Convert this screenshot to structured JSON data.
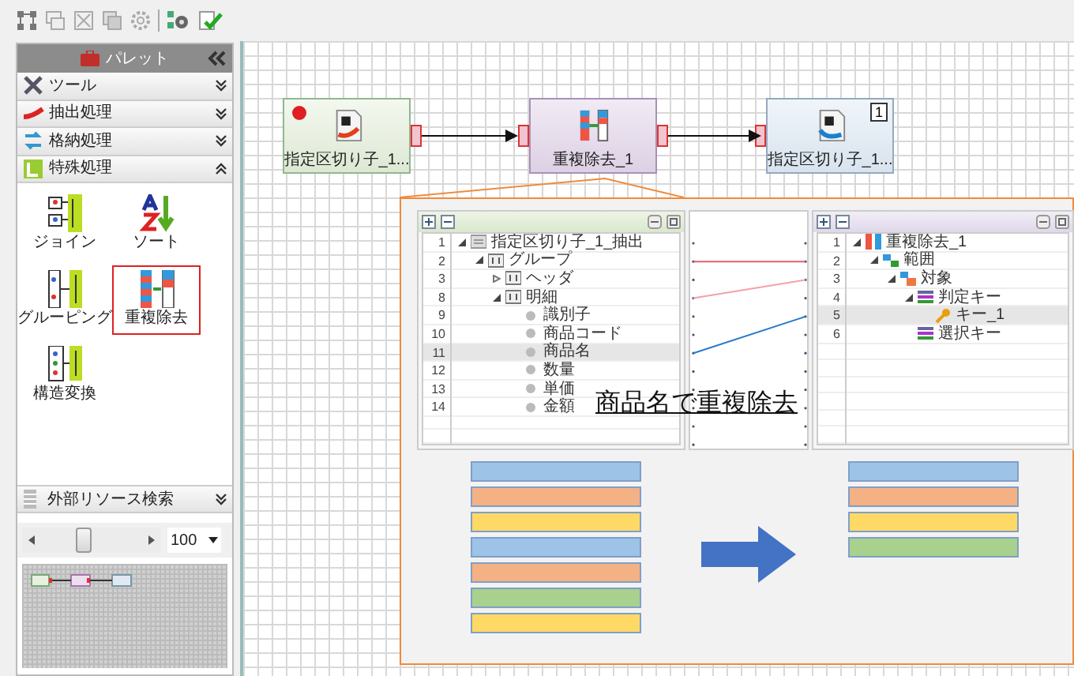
{
  "palette": {
    "title": "パレット",
    "sections": [
      {
        "label": "ツール",
        "expanded": false
      },
      {
        "label": "抽出処理",
        "expanded": false
      },
      {
        "label": "格納処理",
        "expanded": false
      },
      {
        "label": "特殊処理",
        "expanded": true
      }
    ],
    "items": [
      {
        "label": "ジョイン",
        "selected": false
      },
      {
        "label": "ソート",
        "selected": false
      },
      {
        "label": "グルーピング",
        "selected": false
      },
      {
        "label": "重複除去",
        "selected": true
      },
      {
        "label": "構造変換",
        "selected": false
      }
    ],
    "search_section": {
      "label": "外部リソース検索",
      "expanded": false
    }
  },
  "zoom": {
    "level": 0.4,
    "value": "100"
  },
  "nodes": [
    {
      "kind": "input",
      "label": "指定区切り子_1...",
      "error": true
    },
    {
      "kind": "process",
      "label": "重複除去_1",
      "error": false
    },
    {
      "kind": "output",
      "label": "指定区切り子_1...",
      "error": false,
      "badge": "1"
    }
  ],
  "callout": {
    "caption": "商品名で重複除去",
    "left_tree": [
      {
        "number": "1",
        "label": "指定区切り子_1_抽出",
        "kind": "record",
        "expanded": true,
        "selected": false,
        "children": [
          {
            "number": "2",
            "label": "グループ",
            "kind": "group",
            "expanded": true,
            "selected": false,
            "children": [
              {
                "number": "3",
                "label": "ヘッダ",
                "kind": "group",
                "expanded": false,
                "selected": false
              },
              {
                "number": "8",
                "label": "明細",
                "kind": "group",
                "expanded": true,
                "selected": false,
                "children": [
                  {
                    "number": "9",
                    "label": "識別子",
                    "kind": "field",
                    "selected": false
                  },
                  {
                    "number": "10",
                    "label": "商品コード",
                    "kind": "field",
                    "selected": false
                  },
                  {
                    "number": "11",
                    "label": "商品名",
                    "kind": "field",
                    "selected": true
                  },
                  {
                    "number": "12",
                    "label": "数量",
                    "kind": "field",
                    "selected": false
                  },
                  {
                    "number": "13",
                    "label": "単価",
                    "kind": "field",
                    "selected": false
                  },
                  {
                    "number": "14",
                    "label": "金額",
                    "kind": "field",
                    "selected": false
                  }
                ]
              }
            ]
          }
        ]
      }
    ],
    "right_tree": [
      {
        "number": "1",
        "label": "重複除去_1",
        "kind": "process",
        "expanded": true,
        "selected": false,
        "children": [
          {
            "number": "2",
            "label": "範囲",
            "kind": "scope",
            "expanded": true,
            "selected": false,
            "children": [
              {
                "number": "3",
                "label": "対象",
                "kind": "target",
                "expanded": true,
                "selected": false,
                "children": [
                  {
                    "number": "4",
                    "label": "判定キー",
                    "kind": "keylist",
                    "expanded": true,
                    "selected": false,
                    "children": [
                      {
                        "number": "5",
                        "label": "キー_1",
                        "kind": "key",
                        "selected": true
                      }
                    ]
                  },
                  {
                    "number": "6",
                    "label": "選択キー",
                    "kind": "keylist",
                    "selected": false
                  }
                ]
              }
            ]
          }
        ]
      }
    ],
    "before": [
      {
        "color": "#9dc3e6"
      },
      {
        "color": "#f4b183"
      },
      {
        "color": "#ffd966"
      },
      {
        "color": "#9dc3e6"
      },
      {
        "color": "#f4b183"
      },
      {
        "color": "#a9d18e"
      },
      {
        "color": "#ffd966"
      }
    ],
    "after": [
      {
        "color": "#9dc3e6"
      },
      {
        "color": "#f4b183"
      },
      {
        "color": "#ffd966"
      },
      {
        "color": "#a9d18e"
      }
    ]
  }
}
